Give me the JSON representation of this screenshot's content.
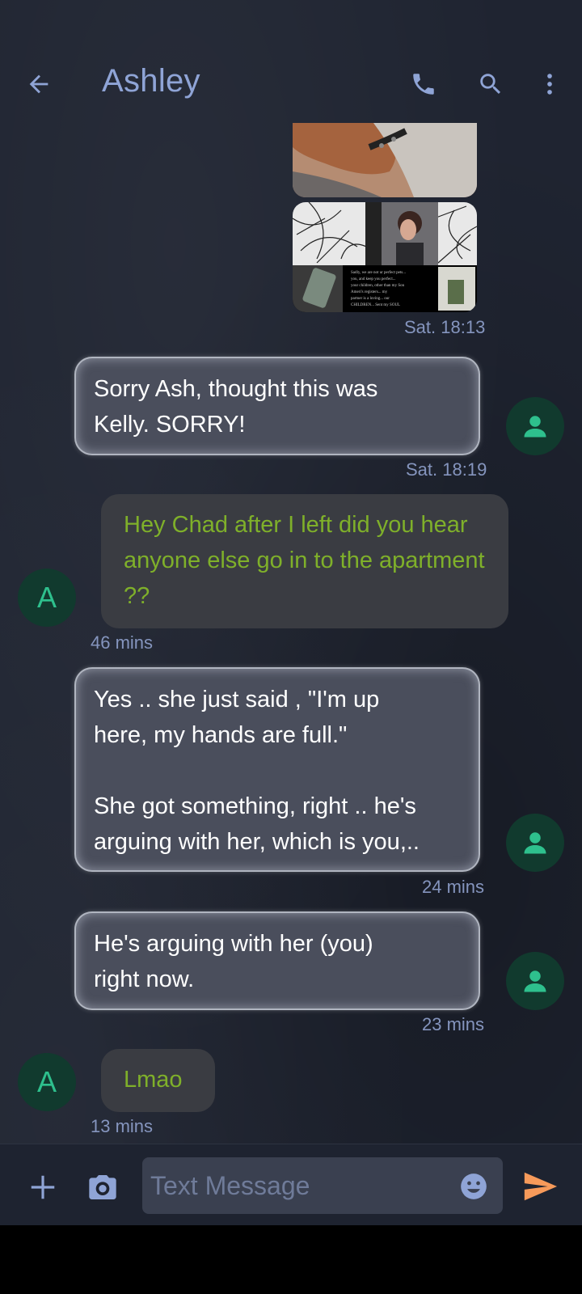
{
  "header": {
    "title": "Ashley"
  },
  "messages": [
    {
      "type": "image",
      "time": ""
    },
    {
      "type": "image",
      "time": "Sat. 18:13"
    },
    {
      "type": "outgoing",
      "text": "Sorry Ash, thought this was\nKelly. SORRY!",
      "time": "Sat. 18:19"
    },
    {
      "type": "incoming",
      "avatar": "A",
      "text": "Hey Chad after I left did you hear anyone else go in to the apartment ??",
      "time": "46 mins"
    },
    {
      "type": "outgoing",
      "text": "Yes .. she just said , \"I'm up\nhere, my hands are full.\"\n\nShe got something, right .. he's\narguing with her, which is you,..",
      "time": "24 mins"
    },
    {
      "type": "outgoing",
      "text": "He's arguing with her (you)\nright now.",
      "time": "23 mins"
    },
    {
      "type": "incoming",
      "avatar": "A",
      "text": "Lmao",
      "time": "13 mins"
    }
  ],
  "compose": {
    "placeholder": "Text Message"
  },
  "colors": {
    "accent": "#8fa4d6",
    "incoming_text": "#7fb02a",
    "avatar_green": "#2ec08d",
    "send": "#f79a5a"
  }
}
